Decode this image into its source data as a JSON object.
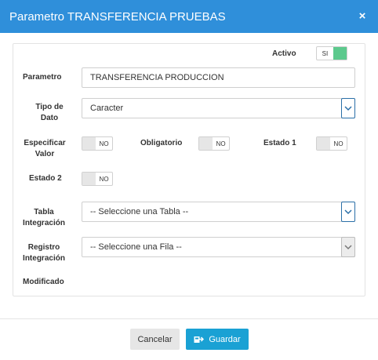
{
  "modal": {
    "title": "Parametro TRANSFERENCIA PRUEBAS",
    "close_label": "×"
  },
  "form": {
    "activo": {
      "label": "Activo",
      "value": "SI"
    },
    "parametro": {
      "label": "Parametro",
      "value": "TRANSFERENCIA PRODUCCION"
    },
    "tipo_de_dato": {
      "label_line1": "Tipo de",
      "label_line2": "Dato",
      "value": "Caracter"
    },
    "especificar_valor": {
      "label_line1": "Especificar",
      "label_line2": "Valor",
      "value": "NO"
    },
    "obligatorio": {
      "label": "Obligatorio",
      "value": "NO"
    },
    "estado1": {
      "label": "Estado 1",
      "value": "NO"
    },
    "estado2": {
      "label": "Estado 2",
      "value": "NO"
    },
    "tabla_integracion": {
      "label_line1": "Tabla",
      "label_line2": "Integración",
      "value": "-- Seleccione una Tabla --"
    },
    "registro_integracion": {
      "label_line1": "Registro",
      "label_line2": "Integración",
      "value": "-- Seleccione una Fila --"
    },
    "modificado": {
      "label": "Modificado"
    }
  },
  "footer": {
    "cancel_label": "Cancelar",
    "save_label": "Guardar"
  },
  "colors": {
    "header": "#2f8fda",
    "toggle_on": "#5cc98d",
    "save_button": "#1aa1d4"
  }
}
